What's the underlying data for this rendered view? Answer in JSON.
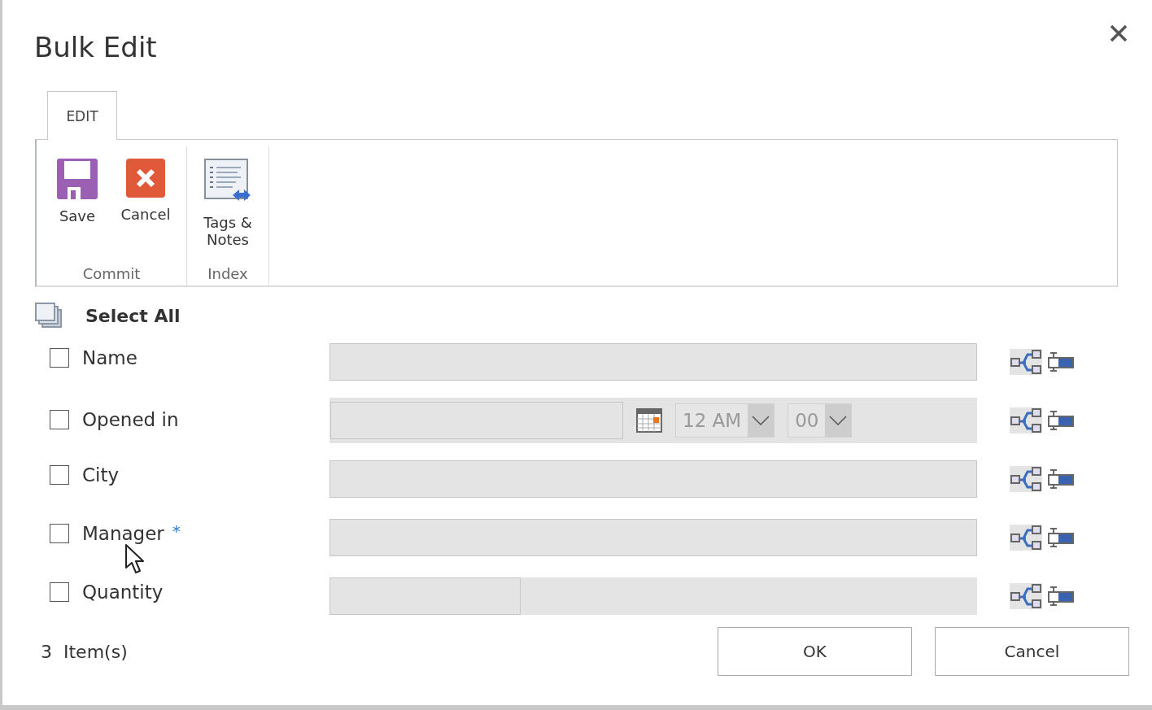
{
  "dialog": {
    "title": "Bulk Edit"
  },
  "ribbon": {
    "tabs": [
      {
        "label": "EDIT",
        "selected": true
      }
    ],
    "groups": [
      {
        "label": "Commit",
        "buttons": [
          {
            "label": "Save",
            "kind": "save"
          },
          {
            "label": "Cancel",
            "kind": "cancel"
          }
        ]
      },
      {
        "label": "Index",
        "buttons": [
          {
            "label": "Tags & Notes",
            "kind": "document"
          }
        ]
      }
    ]
  },
  "select_all": {
    "label": "Select All"
  },
  "fields": [
    {
      "kind": "text",
      "label": "Name",
      "checked": false,
      "disabled": true
    },
    {
      "kind": "datetime",
      "label": "Opened in",
      "checked": false,
      "disabled": true,
      "hour": "12 AM",
      "minute": "00"
    },
    {
      "kind": "text",
      "label": "City",
      "checked": false,
      "disabled": true
    },
    {
      "kind": "text",
      "label": "Manager",
      "required_mark": "*",
      "checked": false,
      "disabled": true
    },
    {
      "kind": "number",
      "label": "Quantity",
      "checked": false,
      "disabled": true
    }
  ],
  "footer": {
    "count": "3",
    "count_label": "Item(s)",
    "buttons": [
      "OK",
      "Cancel"
    ]
  }
}
